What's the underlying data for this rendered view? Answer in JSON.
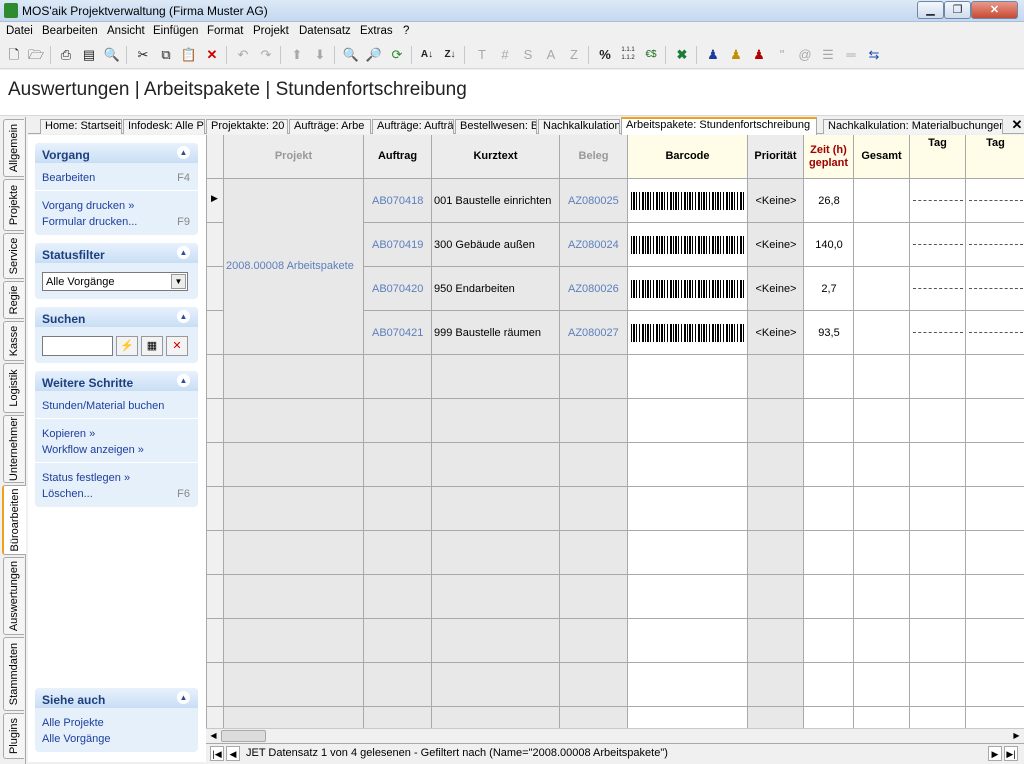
{
  "window": {
    "title": "MOS'aik Projektverwaltung (Firma Muster AG)"
  },
  "menu": [
    "Datei",
    "Bearbeiten",
    "Ansicht",
    "Einfügen",
    "Format",
    "Projekt",
    "Datensatz",
    "Extras",
    "?"
  ],
  "toolbar": {
    "text_buttons": [
      "T",
      "#",
      "S",
      "A",
      "Z",
      "%",
      "1.1.1 1.1.2",
      "€$",
      "\""
    ]
  },
  "page": {
    "title": "Auswertungen | Arbeitspakete | Stundenfortschreibung"
  },
  "side_tabs": [
    "Allgemein",
    "Projekte",
    "Service",
    "Regie",
    "Kasse",
    "Logistik",
    "Unternehmer",
    "Büroarbeiten",
    "Auswertungen",
    "Stammdaten",
    "Plugins"
  ],
  "doc_tabs": [
    "Home: Startseite",
    "Infodesk: Alle P",
    "Projektakte: 20",
    "Aufträge: Arbe",
    "Aufträge: Aufträ",
    "Bestellwesen: B",
    "Nachkalkulation",
    "Arbeitspakete: Stundenfortschreibung",
    "Nachkalkulation: Materialbuchungen"
  ],
  "sidebar": {
    "vorgang": {
      "title": "Vorgang",
      "items": [
        {
          "label": "Bearbeiten",
          "key": "F4"
        },
        {
          "label": "Vorgang drucken »",
          "key": ""
        },
        {
          "label": "Formular drucken...",
          "key": "F9"
        }
      ]
    },
    "statusfilter": {
      "title": "Statusfilter",
      "selected": "Alle Vorgänge"
    },
    "suchen": {
      "title": "Suchen",
      "value": ""
    },
    "weitere": {
      "title": "Weitere Schritte",
      "items": [
        {
          "label": "Stunden/Material buchen",
          "key": ""
        },
        {
          "label": "Kopieren »",
          "key": ""
        },
        {
          "label": "Workflow anzeigen »",
          "key": ""
        },
        {
          "label": "Status festlegen »",
          "key": ""
        },
        {
          "label": "Löschen...",
          "key": "F6"
        }
      ]
    },
    "siehe": {
      "title": "Siehe auch",
      "items": [
        "Alle Projekte",
        "Alle Vorgänge"
      ]
    }
  },
  "grid": {
    "columns": [
      "Projekt",
      "Auftrag",
      "Kurztext",
      "Beleg",
      "Barcode",
      "Priorität",
      "Zeit (h) geplant",
      "Gesamt",
      "Tag",
      "Tag"
    ],
    "project": "2008.00008 Arbeitspakete",
    "rows": [
      {
        "auftrag": "AB070418",
        "kurztext": "001 Baustelle einrichten",
        "beleg": "AZ080025",
        "prioritaet": "<Keine>",
        "zeit": "26,8"
      },
      {
        "auftrag": "AB070419",
        "kurztext": "300 Gebäude außen",
        "beleg": "AZ080024",
        "prioritaet": "<Keine>",
        "zeit": "140,0"
      },
      {
        "auftrag": "AB070420",
        "kurztext": "950 Endarbeiten",
        "beleg": "AZ080026",
        "prioritaet": "<Keine>",
        "zeit": "2,7"
      },
      {
        "auftrag": "AB070421",
        "kurztext": "999 Baustelle räumen",
        "beleg": "AZ080027",
        "prioritaet": "<Keine>",
        "zeit": "93,5"
      }
    ]
  },
  "status": {
    "text": "JET Datensatz 1 von 4 gelesenen - Gefiltert nach (Name=\"2008.00008 Arbeitspakete\")"
  }
}
